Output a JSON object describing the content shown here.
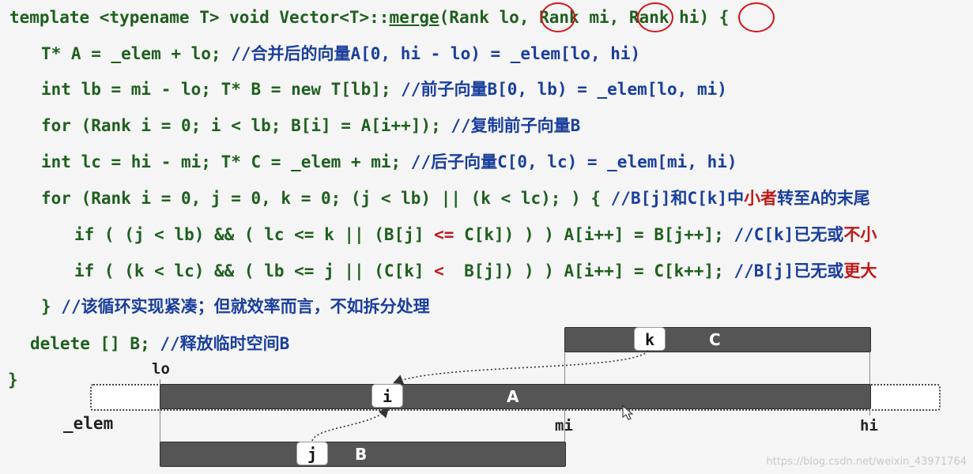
{
  "code": {
    "line1": {
      "a": "template <typename T> void Vector<T>::",
      "fn": "merge",
      "b": "(Rank ",
      "p1": "lo",
      ",": ", ",
      "c": "Rank ",
      "p2": "mi",
      "d": ", Rank ",
      "p3": "hi",
      "e": ") {"
    },
    "line2": {
      "code": "T* A = _elem + lo; ",
      "comment": "//合并后的向量A[0, hi - lo) = _elem[lo, hi)"
    },
    "line3": {
      "code": "int lb = mi - lo; T* B = new T[lb]; ",
      "comment": "//前子向量B[0, lb) = _elem[lo, mi)"
    },
    "line4": {
      "code": "for (Rank i = 0; i < lb; B[i] = A[i++]); ",
      "comment": "//复制前子向量B"
    },
    "line5": {
      "code": "int lc = hi - mi; T* C = _elem + mi; ",
      "comment": "//后子向量C[0, lc) = _elem[mi, hi)"
    },
    "line6": {
      "code": "for (Rank i = 0, j = 0, k = 0; (j < lb) || (k < lc); ) { ",
      "c1": "//B[j]和C[k]中",
      "c2": "小者",
      "c3": "转至A的末尾"
    },
    "line7": {
      "a": "if ( (j < lb) && ( lc <= k || (B[j] ",
      "op": "<=",
      "b": " C[k]) ) ) A[i++] = B[j++]; ",
      "c1": "//C[k]已无或",
      "c2": "不小"
    },
    "line8": {
      "a": "if ( (k < lc) && ( lb <= j || (C[k] ",
      "op": "<",
      "b": "  B[j]) ) ) A[i++] = C[k++]; ",
      "c1": "//B[j]已无或",
      "c2": "更大"
    },
    "line9": {
      "code": "} ",
      "comment": "//该循环实现紧凑；但就效率而言，不如拆分处理"
    },
    "line10": {
      "code": "delete [] B; ",
      "comment": "//释放临时空间B"
    },
    "line11": {
      "code": "}"
    }
  },
  "diagram": {
    "labels": {
      "lo": "lo",
      "mi": "mi",
      "hi": "hi",
      "elem": "_elem"
    },
    "arrays": {
      "a": "A",
      "b": "B",
      "c": "C"
    },
    "pointers": {
      "i": "i",
      "j": "j",
      "k": "k"
    }
  },
  "watermark": "https://blog.csdn.net/weixin_43971764",
  "colors": {
    "code": "#1f5f1f",
    "comment": "#1a3e9c",
    "highlight": "#c01818",
    "bar": "#555555",
    "circle": "#d4141a"
  }
}
